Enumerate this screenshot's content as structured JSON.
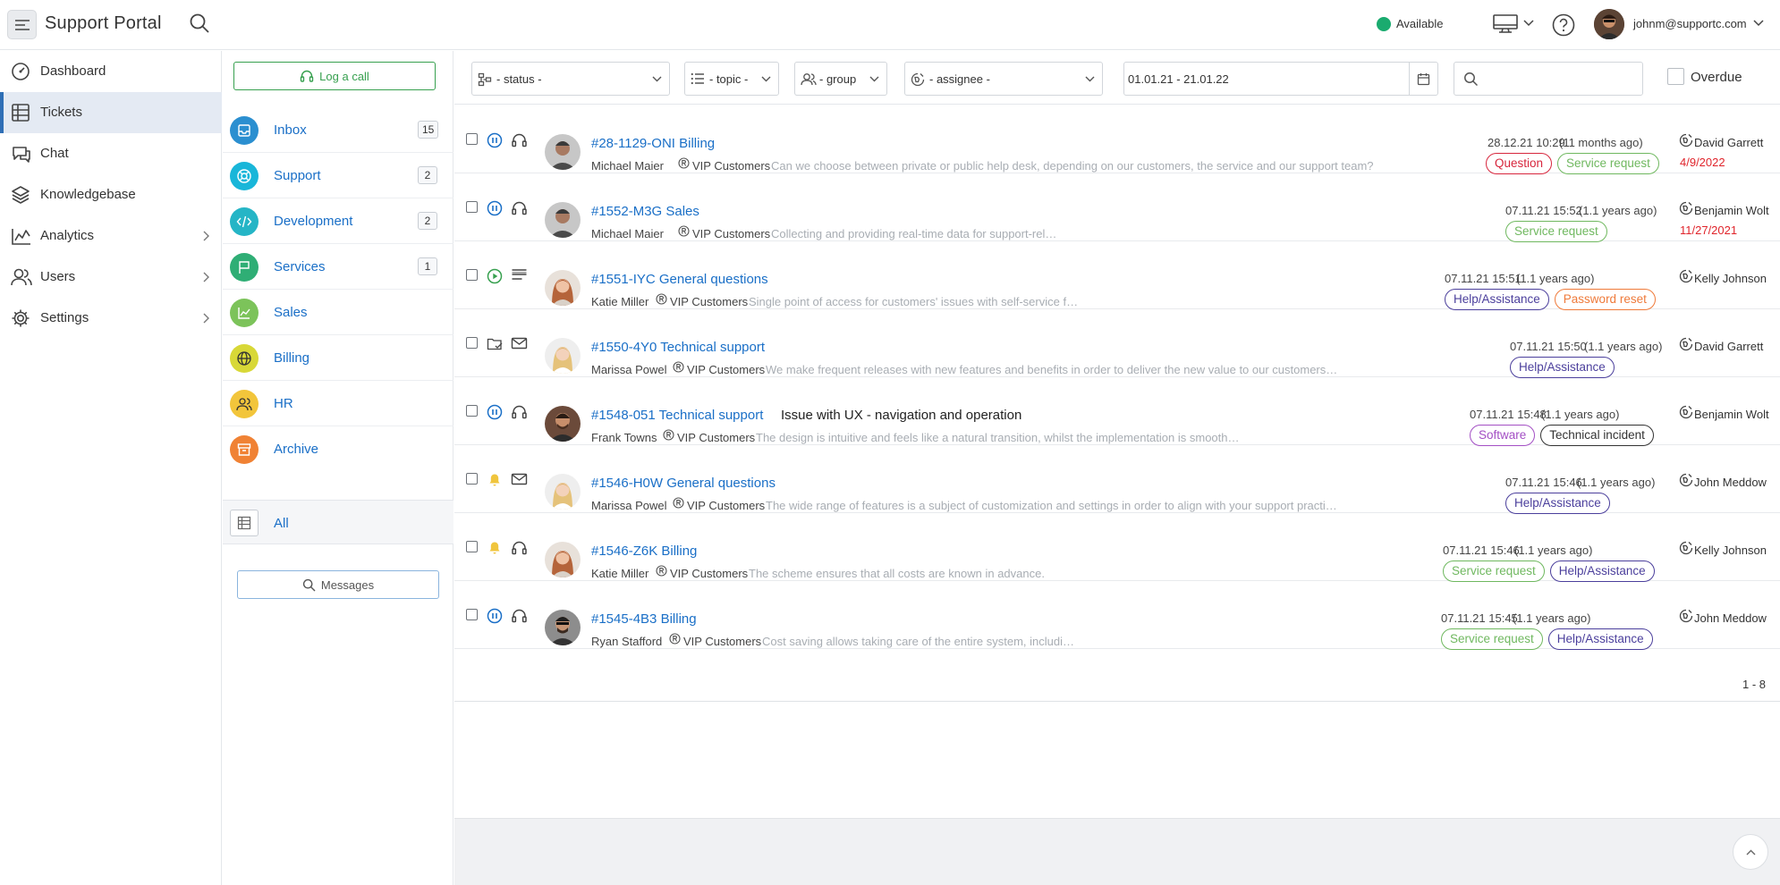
{
  "header": {
    "app_title": "Support Portal",
    "availability": "Available",
    "user_email": "johnm@supportc.com",
    "colors": {
      "available": "#1aab6f",
      "link": "#1a6fc7"
    }
  },
  "sidebar": {
    "items": [
      {
        "label": "Dashboard",
        "icon": "dashboard-icon"
      },
      {
        "label": "Tickets",
        "icon": "tickets-icon",
        "active": true
      },
      {
        "label": "Chat",
        "icon": "chat-icon"
      },
      {
        "label": "Knowledgebase",
        "icon": "layers-icon"
      },
      {
        "label": "Analytics",
        "icon": "analytics-icon",
        "expandable": true
      },
      {
        "label": "Users",
        "icon": "users-icon",
        "expandable": true
      },
      {
        "label": "Settings",
        "icon": "gear-icon",
        "expandable": true
      }
    ]
  },
  "folders": {
    "log_call_label": "Log a call",
    "items": [
      {
        "label": "Inbox",
        "count": "15",
        "color": "#2b8fd0",
        "icon": "inbox-icon"
      },
      {
        "label": "Support",
        "count": "2",
        "color": "#19b6d9",
        "icon": "lifebuoy-icon"
      },
      {
        "label": "Development",
        "count": "2",
        "color": "#25b5c6",
        "icon": "code-icon"
      },
      {
        "label": "Services",
        "count": "1",
        "color": "#2fae75",
        "icon": "flag-icon"
      },
      {
        "label": "Sales",
        "count": "",
        "color": "#7cc35a",
        "icon": "chart-icon"
      },
      {
        "label": "Billing",
        "count": "",
        "color": "#d8d837",
        "icon": "globe-icon"
      },
      {
        "label": "HR",
        "count": "",
        "color": "#f2c53b",
        "icon": "people-icon"
      },
      {
        "label": "Archive",
        "count": "",
        "color": "#f08234",
        "icon": "archive-icon"
      }
    ],
    "all_label": "All",
    "messages_label": "Messages"
  },
  "filters": {
    "status": "- status -",
    "topic": "- topic -",
    "group": "- group",
    "assignee": "- assignee -",
    "date_range": "01.01.21 - 21.01.22",
    "search_value": "",
    "overdue_label": "Overdue"
  },
  "tickets": [
    {
      "title": "#28-1129-ONI Billing",
      "subject": "",
      "customer": "Michael Maier",
      "org": "VIP Customers",
      "description": "Can we choose between private or public help desk, depending on our customers, the service and our support team?",
      "date": "28.12.21 10:29",
      "ago": "(11 months ago)",
      "tags": [
        {
          "label": "Question",
          "color": "#d7263d"
        },
        {
          "label": "Service request",
          "color": "#6fb85f"
        }
      ],
      "assignee": "David Garrett",
      "due": "4/9/2022",
      "state": "pause-icon",
      "channel": "headset-icon",
      "avatar": "m1"
    },
    {
      "title": "#1552-M3G Sales",
      "subject": "",
      "customer": "Michael Maier",
      "org": "VIP Customers",
      "description": "Collecting and providing real-time data for support-related metrics.",
      "date": "07.11.21 15:52",
      "ago": "(1.1 years ago)",
      "tags": [
        {
          "label": "Service request",
          "color": "#6fb85f"
        }
      ],
      "assignee": "Benjamin Wolt",
      "due": "11/27/2021",
      "state": "pause-icon",
      "channel": "headset-icon",
      "avatar": "m1"
    },
    {
      "title": "#1551-IYC General questions",
      "subject": "",
      "customer": "Katie Miller",
      "org": "VIP Customers",
      "description": "Single point of access for customers' issues with self-service features.",
      "date": "07.11.21 15:51",
      "ago": "(1.1 years ago)",
      "tags": [
        {
          "label": "Help/Assistance",
          "color": "#4b3f9c"
        },
        {
          "label": "Password reset",
          "color": "#ef7a3a"
        }
      ],
      "assignee": "Kelly Johnson",
      "due": "",
      "state": "play-icon",
      "channel": "form-icon",
      "avatar": "f1"
    },
    {
      "title": "#1550-4Y0 Technical support",
      "subject": "",
      "customer": "Marissa Powel",
      "org": "VIP Customers",
      "description": "We make frequent releases with new features and benefits in order to deliver the new value to our customers and improve their support experience.",
      "date": "07.11.21 15:50",
      "ago": "(1.1 years ago)",
      "tags": [
        {
          "label": "Help/Assistance",
          "color": "#4b3f9c"
        }
      ],
      "assignee": "David Garrett",
      "due": "",
      "state": "folder-check-icon",
      "channel": "mail-icon",
      "avatar": "f2"
    },
    {
      "title": "#1548-051 Technical support",
      "subject": "Issue with UX - navigation and operation",
      "customer": "Frank Towns",
      "org": "VIP Customers",
      "description": "The design is intuitive and feels like a natural transition, whilst the implementation is smooth without a steep learning curve.",
      "date": "07.11.21 15:48",
      "ago": "(1.1 years ago)",
      "tags": [
        {
          "label": "Software",
          "color": "#a34fc4"
        },
        {
          "label": "Technical incident",
          "color": "#333333"
        }
      ],
      "assignee": "Benjamin Wolt",
      "due": "",
      "state": "pause-icon",
      "channel": "headset-icon",
      "avatar": "m2"
    },
    {
      "title": "#1546-H0W General questions",
      "subject": "",
      "customer": "Marissa Powel",
      "org": "VIP Customers",
      "description": "The wide range of features is a subject of customization and settings in order to align with your support practice and the volume of daily requests.",
      "date": "07.11.21 15:46",
      "ago": "(1.1 years ago)",
      "tags": [
        {
          "label": "Help/Assistance",
          "color": "#4b3f9c"
        }
      ],
      "assignee": "John Meddow",
      "due": "",
      "state": "bell-icon",
      "channel": "mail-icon",
      "avatar": "f2"
    },
    {
      "title": "#1546-Z6K Billing",
      "subject": "",
      "customer": "Katie Miller",
      "org": "VIP Customers",
      "description": "The scheme ensures that all costs are known in advance.",
      "date": "07.11.21 15:46",
      "ago": "(1.1 years ago)",
      "tags": [
        {
          "label": "Service request",
          "color": "#6fb85f"
        },
        {
          "label": "Help/Assistance",
          "color": "#4b3f9c"
        }
      ],
      "assignee": "Kelly Johnson",
      "due": "",
      "state": "bell-icon",
      "channel": "headset-icon",
      "avatar": "f1"
    },
    {
      "title": "#1545-4B3 Billing",
      "subject": "",
      "customer": "Ryan Stafford",
      "org": "VIP Customers",
      "description": "Cost saving allows taking care of the entire system, including availability and backups.",
      "date": "07.11.21 15:45",
      "ago": "(1.1 years ago)",
      "tags": [
        {
          "label": "Service request",
          "color": "#6fb85f"
        },
        {
          "label": "Help/Assistance",
          "color": "#4b3f9c"
        }
      ],
      "assignee": "John Meddow",
      "due": "",
      "state": "pause-icon",
      "channel": "headset-icon",
      "avatar": "m3"
    }
  ],
  "pager": {
    "range": "1 - 8"
  }
}
